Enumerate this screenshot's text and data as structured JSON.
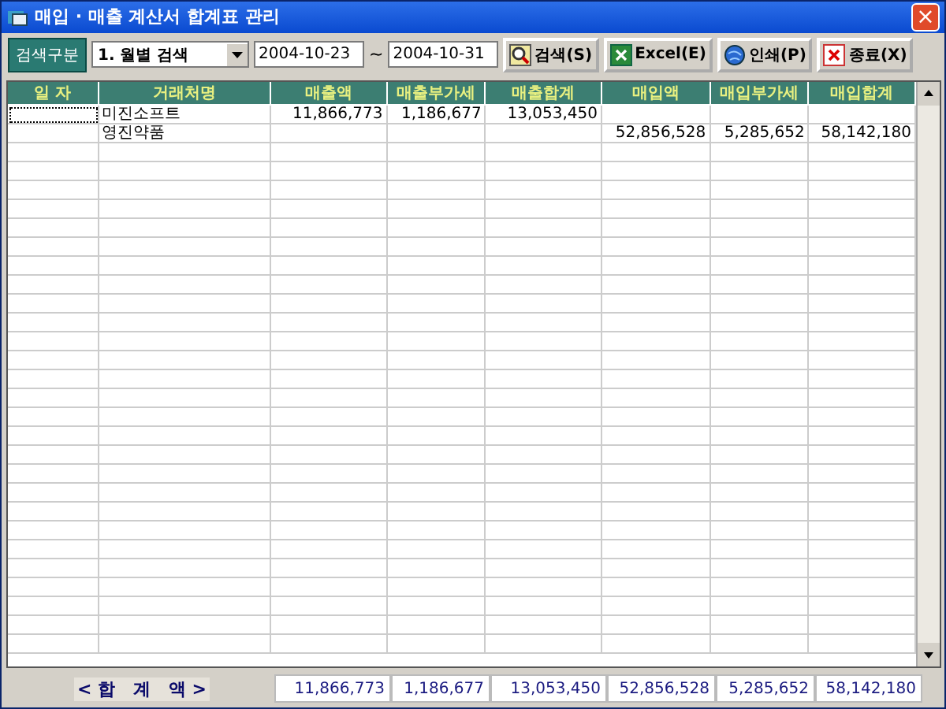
{
  "window": {
    "title": "매입 · 매출 계산서 합계표 관리",
    "close": "×"
  },
  "toolbar": {
    "search_label": "검색구분",
    "mode": "1. 월별 검색",
    "date_from": "2004-10-23",
    "separator": "~",
    "date_to": "2004-10-31",
    "buttons": [
      {
        "kind": "search",
        "label": "검색(S)"
      },
      {
        "kind": "excel",
        "label": "Excel(E)"
      },
      {
        "kind": "print",
        "label": "인쇄(P)"
      },
      {
        "kind": "close",
        "label": "종료(X)"
      }
    ]
  },
  "table": {
    "columns": [
      "일 자",
      "거래처명",
      "매출액",
      "매출부가세",
      "매출합계",
      "매입액",
      "매입부가세",
      "매입합계"
    ],
    "rows": [
      {
        "selected": true,
        "cells": [
          "",
          "미진소프트",
          "11,866,773",
          "1,186,677",
          "13,053,450",
          "",
          "",
          ""
        ]
      },
      {
        "selected": false,
        "cells": [
          "",
          "영진약품",
          "",
          "",
          "",
          "52,856,528",
          "5,285,652",
          "58,142,180"
        ]
      }
    ]
  },
  "footer": {
    "label": "< 합   계   액 >",
    "totals": [
      "11,866,773",
      "1,186,677",
      "13,053,450",
      "52,856,528",
      "5,285,652",
      "58,142,180"
    ]
  }
}
